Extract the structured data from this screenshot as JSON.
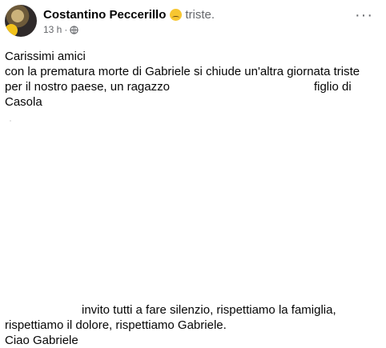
{
  "post": {
    "author": "Costantino Peccerillo",
    "feeling": "triste.",
    "time": "13 h",
    "separator": "·",
    "more_label": "···",
    "line1": "Carissimi amici",
    "line2": "con la prematura morte di Gabriele si chiude un'altra giornata triste",
    "line3_start": "per il nostro paese, un ragazzo",
    "line3_end": "figlio di Casola",
    "line4_end": "invito tutti a fare silenzio, rispettiamo la famiglia,",
    "line5": "rispettiamo il dolore, rispettiamo Gabriele.",
    "line6": "Ciao Gabriele"
  },
  "icons": {
    "feeling": "sad-face-icon",
    "privacy": "globe-icon",
    "more": "more-horizontal-icon"
  },
  "colors": {
    "text": "#050505",
    "secondary": "#65676b",
    "emoji": "#f7c631"
  }
}
